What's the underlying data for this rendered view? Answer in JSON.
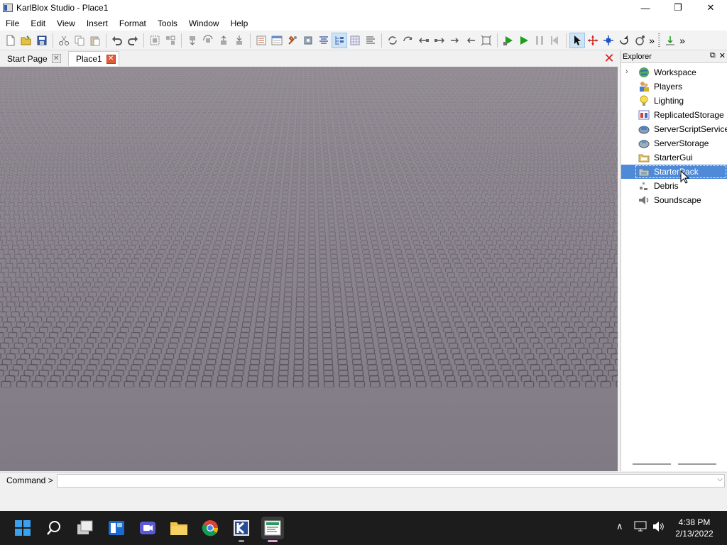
{
  "window": {
    "title": "KarlBlox Studio - Place1",
    "minimize": "—",
    "restore": "❐",
    "close": "✕"
  },
  "menu": [
    "File",
    "Edit",
    "View",
    "Insert",
    "Format",
    "Tools",
    "Window",
    "Help"
  ],
  "toolbar": {
    "icons": [
      "new-icon",
      "open-icon",
      "save-icon",
      "cut-icon",
      "copy-icon",
      "paste-icon",
      "undo-icon",
      "redo-icon",
      "group-icon",
      "ungroup-icon",
      "drop-icon",
      "rotate-icon",
      "lift-icon",
      "lower-icon",
      "explorer-icon",
      "properties-icon",
      "toolbox-icon",
      "tools-icon",
      "align-icon",
      "tree-icon",
      "grid-icon",
      "output-icon",
      "camera-pan-icon",
      "camera-rotate-icon",
      "camera-left-icon",
      "camera-right-icon",
      "camera-forward-icon",
      "camera-back-icon",
      "zoom-extents-icon",
      "run-icon",
      "play-icon",
      "pause-icon",
      "stop-icon",
      "select-icon",
      "move-icon",
      "resize-icon",
      "rotate-tool-icon",
      "anchor-icon",
      "more-icon",
      "export-icon",
      "more-icon-2"
    ],
    "active_index": 19,
    "overflow": "»"
  },
  "tabs": [
    {
      "label": "Start Page",
      "close": "✕"
    },
    {
      "label": "Place1",
      "close": "✕"
    }
  ],
  "close_document": "✕",
  "explorer": {
    "title": "Explorer",
    "pin": "⧉",
    "close": "✕",
    "expander": "›",
    "items": [
      {
        "label": "Workspace",
        "icon": "workspace-icon",
        "expandable": true
      },
      {
        "label": "Players",
        "icon": "players-icon"
      },
      {
        "label": "Lighting",
        "icon": "lighting-icon"
      },
      {
        "label": "ReplicatedStorage",
        "icon": "replicated-storage-icon"
      },
      {
        "label": "ServerScriptService",
        "icon": "server-script-service-icon"
      },
      {
        "label": "ServerStorage",
        "icon": "server-storage-icon"
      },
      {
        "label": "StarterGui",
        "icon": "starter-gui-icon"
      },
      {
        "label": "StarterPack",
        "icon": "starter-pack-icon",
        "selected": true
      },
      {
        "label": "Debris",
        "icon": "debris-icon"
      },
      {
        "label": "Soundscape",
        "icon": "soundscape-icon"
      }
    ]
  },
  "command": {
    "label": "Command >",
    "value": "",
    "dropdown": "⌵"
  },
  "taskbar": {
    "apps": [
      "windows-start-icon",
      "search-icon",
      "task-view-icon",
      "widgets-icon",
      "chat-icon",
      "file-explorer-icon",
      "chrome-icon",
      "karlblox-icon",
      "karlblox-studio-icon"
    ],
    "tray": {
      "chevron": "∧",
      "network": "🖥",
      "volume": "🔊"
    },
    "time": "4:38 PM",
    "date": "2/13/2022"
  }
}
